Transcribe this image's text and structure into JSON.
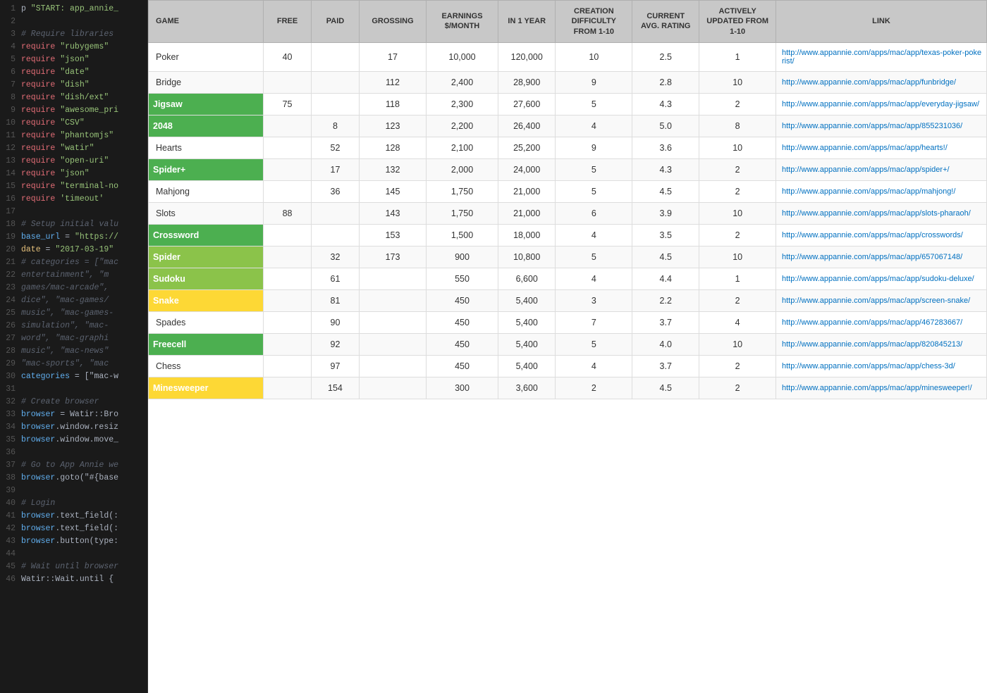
{
  "code": {
    "lines": [
      {
        "num": 1,
        "tokens": [
          {
            "t": "p",
            "c": "kw-white"
          },
          {
            "t": " \"START: app_annie_",
            "c": "kw-green"
          }
        ]
      },
      {
        "num": 2,
        "tokens": []
      },
      {
        "num": 3,
        "tokens": [
          {
            "t": "# Require libraries",
            "c": "kw-comment"
          }
        ]
      },
      {
        "num": 4,
        "tokens": [
          {
            "t": "require",
            "c": "kw-red"
          },
          {
            "t": " \"rubygems\"",
            "c": "kw-green"
          }
        ]
      },
      {
        "num": 5,
        "tokens": [
          {
            "t": "require",
            "c": "kw-red"
          },
          {
            "t": " \"json\"",
            "c": "kw-green"
          }
        ]
      },
      {
        "num": 6,
        "tokens": [
          {
            "t": "require",
            "c": "kw-red"
          },
          {
            "t": " \"date\"",
            "c": "kw-green"
          }
        ]
      },
      {
        "num": 7,
        "tokens": [
          {
            "t": "require",
            "c": "kw-red"
          },
          {
            "t": " \"dish\"",
            "c": "kw-green"
          }
        ]
      },
      {
        "num": 8,
        "tokens": [
          {
            "t": "require",
            "c": "kw-red"
          },
          {
            "t": " \"dish/ext\"",
            "c": "kw-green"
          }
        ]
      },
      {
        "num": 9,
        "tokens": [
          {
            "t": "require",
            "c": "kw-red"
          },
          {
            "t": " \"awesome_pri",
            "c": "kw-green"
          }
        ]
      },
      {
        "num": 10,
        "tokens": [
          {
            "t": "require",
            "c": "kw-red"
          },
          {
            "t": " \"CSV\"",
            "c": "kw-green"
          }
        ]
      },
      {
        "num": 11,
        "tokens": [
          {
            "t": "require",
            "c": "kw-red"
          },
          {
            "t": " \"phantomjs\"",
            "c": "kw-green"
          }
        ]
      },
      {
        "num": 12,
        "tokens": [
          {
            "t": "require",
            "c": "kw-red"
          },
          {
            "t": " \"watir\"",
            "c": "kw-green"
          }
        ]
      },
      {
        "num": 13,
        "tokens": [
          {
            "t": "require",
            "c": "kw-red"
          },
          {
            "t": " \"open-uri\"",
            "c": "kw-green"
          }
        ]
      },
      {
        "num": 14,
        "tokens": [
          {
            "t": "require",
            "c": "kw-red"
          },
          {
            "t": " \"json\"",
            "c": "kw-green"
          }
        ]
      },
      {
        "num": 15,
        "tokens": [
          {
            "t": "require",
            "c": "kw-red"
          },
          {
            "t": " \"terminal-no",
            "c": "kw-green"
          }
        ]
      },
      {
        "num": 16,
        "tokens": [
          {
            "t": "require",
            "c": "kw-red"
          },
          {
            "t": " 'timeout'",
            "c": "kw-green"
          }
        ]
      },
      {
        "num": 17,
        "tokens": []
      },
      {
        "num": 18,
        "tokens": [
          {
            "t": "# Setup initial valu",
            "c": "kw-comment"
          }
        ]
      },
      {
        "num": 19,
        "tokens": [
          {
            "t": "base_url",
            "c": "kw-blue"
          },
          {
            "t": " = ",
            "c": "kw-white"
          },
          {
            "t": "\"https://",
            "c": "kw-green"
          }
        ]
      },
      {
        "num": 20,
        "tokens": [
          {
            "t": "date",
            "c": "kw-yellow"
          },
          {
            "t": " = ",
            "c": "kw-white"
          },
          {
            "t": "\"2017-03-19\"",
            "c": "kw-green"
          }
        ]
      },
      {
        "num": 21,
        "tokens": [
          {
            "t": "# categories = [\"mac",
            "c": "kw-comment"
          }
        ]
      },
      {
        "num": 22,
        "tokens": [
          {
            "t": "  entertainment",
            "c": "kw-comment"
          },
          {
            "t": "\", \"m",
            "c": "kw-comment"
          }
        ]
      },
      {
        "num": 23,
        "tokens": [
          {
            "t": "  games/mac-arcade",
            "c": "kw-comment"
          },
          {
            "t": "\",",
            "c": "kw-comment"
          }
        ]
      },
      {
        "num": 24,
        "tokens": [
          {
            "t": "  dice",
            "c": "kw-comment"
          },
          {
            "t": "\", \"mac-games/",
            "c": "kw-comment"
          }
        ]
      },
      {
        "num": 25,
        "tokens": [
          {
            "t": "  music",
            "c": "kw-comment"
          },
          {
            "t": "\", \"mac-games-",
            "c": "kw-comment"
          }
        ]
      },
      {
        "num": 26,
        "tokens": [
          {
            "t": "  simulation",
            "c": "kw-comment"
          },
          {
            "t": "\", \"mac-",
            "c": "kw-comment"
          }
        ]
      },
      {
        "num": 27,
        "tokens": [
          {
            "t": "  word",
            "c": "kw-comment"
          },
          {
            "t": "\", \"mac-graphi",
            "c": "kw-comment"
          }
        ]
      },
      {
        "num": 28,
        "tokens": [
          {
            "t": "  music",
            "c": "kw-comment"
          },
          {
            "t": "\", \"mac-news\"",
            "c": "kw-comment"
          }
        ]
      },
      {
        "num": 29,
        "tokens": [
          {
            "t": "  \"mac-sports\"",
            "c": "kw-comment"
          },
          {
            "t": ", \"mac",
            "c": "kw-comment"
          }
        ]
      },
      {
        "num": 30,
        "tokens": [
          {
            "t": "categories",
            "c": "kw-blue"
          },
          {
            "t": " = [\"mac-w",
            "c": "kw-white"
          }
        ]
      },
      {
        "num": 31,
        "tokens": []
      },
      {
        "num": 32,
        "tokens": [
          {
            "t": "# Create browser",
            "c": "kw-comment"
          }
        ]
      },
      {
        "num": 33,
        "tokens": [
          {
            "t": "browser",
            "c": "kw-blue"
          },
          {
            "t": " = Watir::Bro",
            "c": "kw-white"
          }
        ]
      },
      {
        "num": 34,
        "tokens": [
          {
            "t": "browser",
            "c": "kw-blue"
          },
          {
            "t": ".window.resiz",
            "c": "kw-white"
          }
        ]
      },
      {
        "num": 35,
        "tokens": [
          {
            "t": "browser",
            "c": "kw-blue"
          },
          {
            "t": ".window.move_",
            "c": "kw-white"
          }
        ]
      },
      {
        "num": 36,
        "tokens": []
      },
      {
        "num": 37,
        "tokens": [
          {
            "t": "# Go to App Annie we",
            "c": "kw-comment"
          }
        ]
      },
      {
        "num": 38,
        "tokens": [
          {
            "t": "browser",
            "c": "kw-blue"
          },
          {
            "t": ".goto(\"#{base",
            "c": "kw-white"
          }
        ]
      },
      {
        "num": 39,
        "tokens": []
      },
      {
        "num": 40,
        "tokens": [
          {
            "t": "# Login",
            "c": "kw-comment"
          }
        ]
      },
      {
        "num": 41,
        "tokens": [
          {
            "t": "browser",
            "c": "kw-blue"
          },
          {
            "t": ".text_field(:",
            "c": "kw-white"
          }
        ]
      },
      {
        "num": 42,
        "tokens": [
          {
            "t": "browser",
            "c": "kw-blue"
          },
          {
            "t": ".text_field(:",
            "c": "kw-white"
          }
        ]
      },
      {
        "num": 43,
        "tokens": [
          {
            "t": "browser",
            "c": "kw-blue"
          },
          {
            "t": ".button(type:",
            "c": "kw-white"
          }
        ]
      },
      {
        "num": 44,
        "tokens": []
      },
      {
        "num": 45,
        "tokens": [
          {
            "t": "# Wait until browser",
            "c": "kw-comment"
          }
        ]
      },
      {
        "num": 46,
        "tokens": [
          {
            "t": "Watir::Wait.until {",
            "c": "kw-white"
          }
        ]
      }
    ]
  },
  "table": {
    "headers": [
      {
        "label": "GAME",
        "key": "game"
      },
      {
        "label": "FREE",
        "key": "free"
      },
      {
        "label": "PAID",
        "key": "paid"
      },
      {
        "label": "GROSSING",
        "key": "grossing"
      },
      {
        "label": "EARNINGS $/MONTH",
        "key": "earnings"
      },
      {
        "label": "IN 1 YEAR",
        "key": "in1year"
      },
      {
        "label": "CREATION DIFFICULTY FROM 1-10",
        "key": "difficulty"
      },
      {
        "label": "CURRENT AVG. RATING",
        "key": "rating"
      },
      {
        "label": "ACTIVELY UPDATED FROM 1-10",
        "key": "updated"
      },
      {
        "label": "LINK",
        "key": "link"
      }
    ],
    "rows": [
      {
        "game": "Poker",
        "highlight": "",
        "free": "40",
        "paid": "",
        "grossing": "17",
        "earnings": "10,000",
        "in1year": "120,000",
        "difficulty": "10",
        "rating": "2.5",
        "updated": "1",
        "link": "http://www.appannie.com/apps/mac/app/texas-poker-pokerist/"
      },
      {
        "game": "Bridge",
        "highlight": "",
        "free": "",
        "paid": "",
        "grossing": "112",
        "earnings": "2,400",
        "in1year": "28,900",
        "difficulty": "9",
        "rating": "2.8",
        "updated": "10",
        "link": "http://www.appannie.com/apps/mac/app/funbridge/"
      },
      {
        "game": "Jigsaw",
        "highlight": "green",
        "free": "75",
        "paid": "",
        "grossing": "118",
        "earnings": "2,300",
        "in1year": "27,600",
        "difficulty": "5",
        "rating": "4.3",
        "updated": "2",
        "link": "http://www.appannie.com/apps/mac/app/everyday-jigsaw/"
      },
      {
        "game": "2048",
        "highlight": "green",
        "free": "",
        "paid": "8",
        "grossing": "123",
        "earnings": "2,200",
        "in1year": "26,400",
        "difficulty": "4",
        "rating": "5.0",
        "updated": "8",
        "link": "http://www.appannie.com/apps/mac/app/855231036/"
      },
      {
        "game": "Hearts",
        "highlight": "",
        "free": "",
        "paid": "52",
        "grossing": "128",
        "earnings": "2,100",
        "in1year": "25,200",
        "difficulty": "9",
        "rating": "3.6",
        "updated": "10",
        "link": "http://www.appannie.com/apps/mac/app/hearts!/"
      },
      {
        "game": "Spider+",
        "highlight": "green",
        "free": "",
        "paid": "17",
        "grossing": "132",
        "earnings": "2,000",
        "in1year": "24,000",
        "difficulty": "5",
        "rating": "4.3",
        "updated": "2",
        "link": "http://www.appannie.com/apps/mac/app/spider+/"
      },
      {
        "game": "Mahjong",
        "highlight": "",
        "free": "",
        "paid": "36",
        "grossing": "145",
        "earnings": "1,750",
        "in1year": "21,000",
        "difficulty": "5",
        "rating": "4.5",
        "updated": "2",
        "link": "http://www.appannie.com/apps/mac/app/mahjong!/"
      },
      {
        "game": "Slots",
        "highlight": "",
        "free": "88",
        "paid": "",
        "grossing": "143",
        "earnings": "1,750",
        "in1year": "21,000",
        "difficulty": "6",
        "rating": "3.9",
        "updated": "10",
        "link": "http://www.appannie.com/apps/mac/app/slots-pharaoh/"
      },
      {
        "game": "Crossword",
        "highlight": "green",
        "free": "",
        "paid": "",
        "grossing": "153",
        "earnings": "1,500",
        "in1year": "18,000",
        "difficulty": "4",
        "rating": "3.5",
        "updated": "2",
        "link": "http://www.appannie.com/apps/mac/app/crosswords/"
      },
      {
        "game": "Spider",
        "highlight": "lightgreen",
        "free": "",
        "paid": "32",
        "grossing": "173",
        "earnings": "900",
        "in1year": "10,800",
        "difficulty": "5",
        "rating": "4.5",
        "updated": "10",
        "link": "http://www.appannie.com/apps/mac/app/657067148/"
      },
      {
        "game": "Sudoku",
        "highlight": "lightgreen",
        "free": "",
        "paid": "61",
        "grossing": "",
        "earnings": "550",
        "in1year": "6,600",
        "difficulty": "4",
        "rating": "4.4",
        "updated": "1",
        "link": "http://www.appannie.com/apps/mac/app/sudoku-deluxe/"
      },
      {
        "game": "Snake",
        "highlight": "yellow",
        "free": "",
        "paid": "81",
        "grossing": "",
        "earnings": "450",
        "in1year": "5,400",
        "difficulty": "3",
        "rating": "2.2",
        "updated": "2",
        "link": "http://www.appannie.com/apps/mac/app/screen-snake/"
      },
      {
        "game": "Spades",
        "highlight": "",
        "free": "",
        "paid": "90",
        "grossing": "",
        "earnings": "450",
        "in1year": "5,400",
        "difficulty": "7",
        "rating": "3.7",
        "updated": "4",
        "link": "http://www.appannie.com/apps/mac/app/467283667/"
      },
      {
        "game": "Freecell",
        "highlight": "green",
        "free": "",
        "paid": "92",
        "grossing": "",
        "earnings": "450",
        "in1year": "5,400",
        "difficulty": "5",
        "rating": "4.0",
        "updated": "10",
        "link": "http://www.appannie.com/apps/mac/app/820845213/"
      },
      {
        "game": "Chess",
        "highlight": "",
        "free": "",
        "paid": "97",
        "grossing": "",
        "earnings": "450",
        "in1year": "5,400",
        "difficulty": "4",
        "rating": "3.7",
        "updated": "2",
        "link": "http://www.appannie.com/apps/mac/app/chess-3d/"
      },
      {
        "game": "Minesweeper",
        "highlight": "yellow",
        "free": "",
        "paid": "154",
        "grossing": "",
        "earnings": "300",
        "in1year": "3,600",
        "difficulty": "2",
        "rating": "4.5",
        "updated": "2",
        "link": "http://www.appannie.com/apps/mac/app/minesweeper!/"
      }
    ]
  }
}
